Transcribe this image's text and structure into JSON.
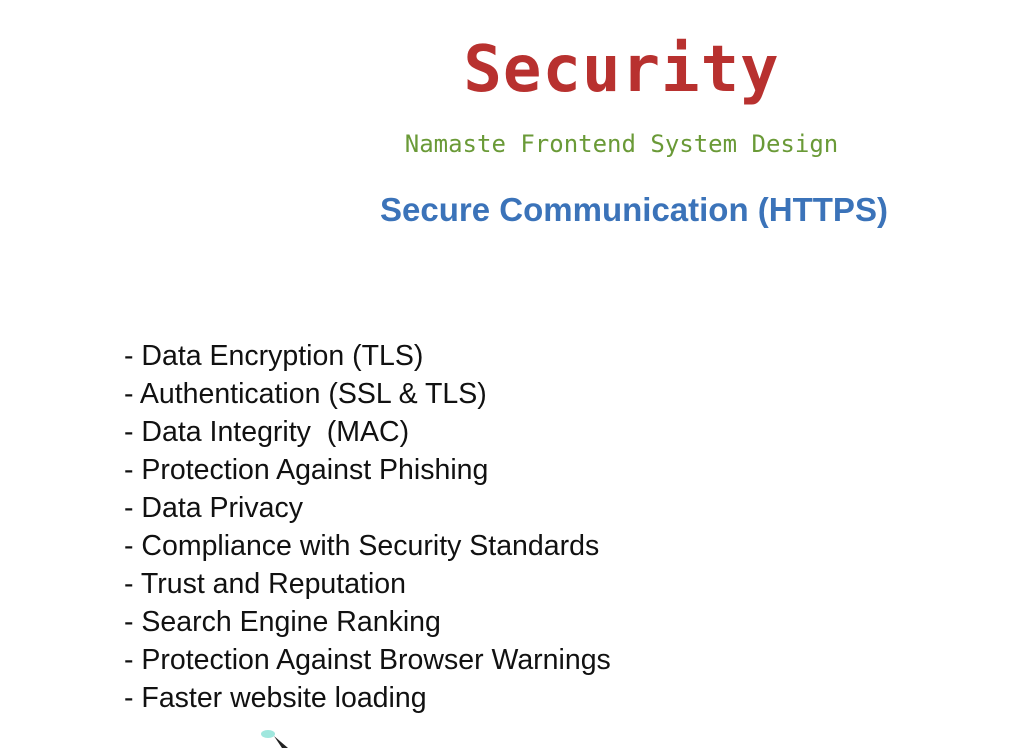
{
  "slide": {
    "title": "Security",
    "subtitle": "Namaste Frontend System Design",
    "heading": "Secure Communication (HTTPS)",
    "bullets": [
      "- Data Encryption (TLS)",
      "- Authentication (SSL & TLS)",
      "- Data Integrity  (MAC)",
      "- Protection Against Phishing",
      "- Data Privacy",
      "- Compliance with Security Standards",
      "- Trust and Reputation",
      "- Search Engine Ranking",
      "- Protection Against Browser Warnings",
      "- Faster website loading"
    ]
  },
  "colors": {
    "title": "#b8312f",
    "subtitle": "#6a9a37",
    "heading": "#3b73b9",
    "body": "#111111"
  }
}
